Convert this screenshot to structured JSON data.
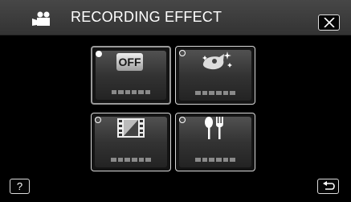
{
  "header": {
    "title": "RECORDING EFFECT",
    "mode_icon": "video-camera-icon",
    "close_icon": "close-icon"
  },
  "effects": [
    {
      "key": "off",
      "label": "OFF",
      "name_text": "▪▪▪▪▪▪",
      "selected": true,
      "icon": "off-badge-icon"
    },
    {
      "key": "sparkle",
      "label": "",
      "name_text": "▪▪▪▪▪▪",
      "selected": false,
      "icon": "sparkle-effect-icon"
    },
    {
      "key": "film",
      "label": "",
      "name_text": "▪▪▪▪▪▪",
      "selected": false,
      "icon": "film-effect-icon"
    },
    {
      "key": "food",
      "label": "",
      "name_text": "▪▪▪▪▪▪",
      "selected": false,
      "icon": "spoon-fork-icon"
    }
  ],
  "footer": {
    "help_label": "?",
    "back_icon": "back-return-icon"
  },
  "colors": {
    "header_bg": "#3a3a3a",
    "screen_bg": "#000000",
    "tile_border": "#d7d7d7",
    "tile_fill": "#3a3a3a"
  }
}
